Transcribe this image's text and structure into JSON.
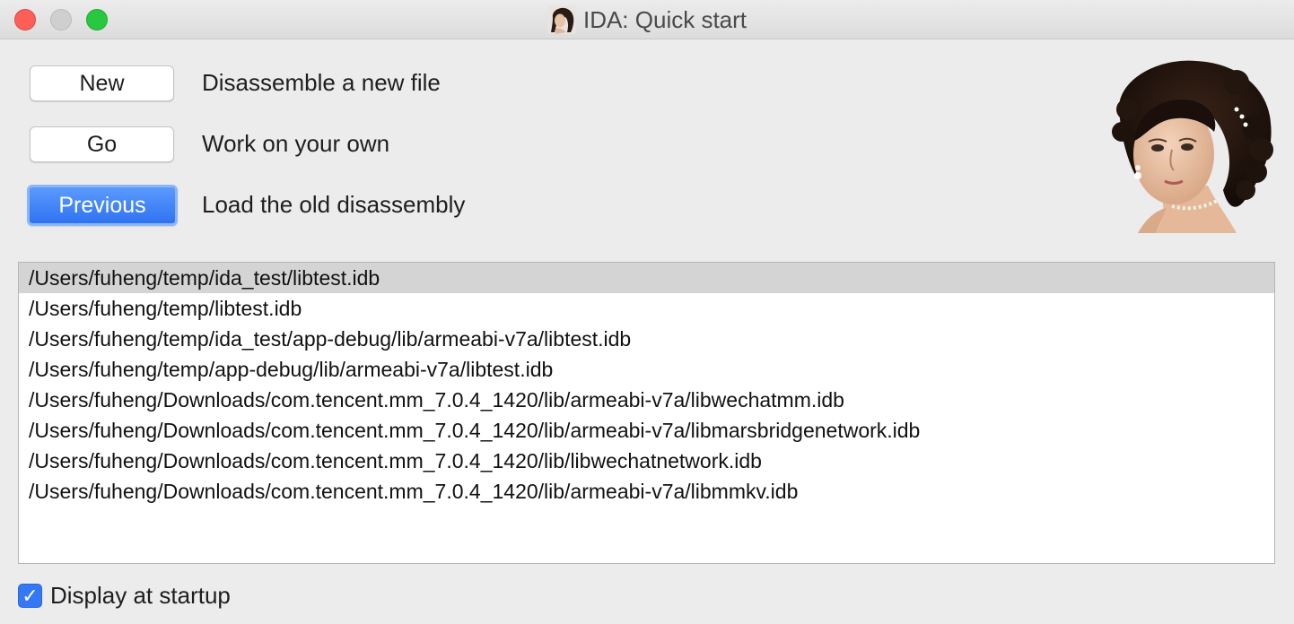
{
  "window": {
    "title": "IDA: Quick start",
    "app_icon": "portrait-icon"
  },
  "actions": [
    {
      "button_label": "New",
      "description": "Disassemble a new file"
    },
    {
      "button_label": "Go",
      "description": "Work on your own"
    },
    {
      "button_label": "Previous",
      "description": "Load the old disassembly",
      "default": true
    }
  ],
  "recent_files": {
    "selected_index": 0,
    "items": [
      "/Users/fuheng/temp/ida_test/libtest.idb",
      "/Users/fuheng/temp/libtest.idb",
      "/Users/fuheng/temp/ida_test/app-debug/lib/armeabi-v7a/libtest.idb",
      "/Users/fuheng/temp/app-debug/lib/armeabi-v7a/libtest.idb",
      "/Users/fuheng/Downloads/com.tencent.mm_7.0.4_1420/lib/armeabi-v7a/libwechatmm.idb",
      "/Users/fuheng/Downloads/com.tencent.mm_7.0.4_1420/lib/armeabi-v7a/libmarsbridgenetwork.idb",
      "/Users/fuheng/Downloads/com.tencent.mm_7.0.4_1420/lib/libwechatnetwork.idb",
      "/Users/fuheng/Downloads/com.tencent.mm_7.0.4_1420/lib/armeabi-v7a/libmmkv.idb"
    ]
  },
  "startup": {
    "label": "Display at startup",
    "checked": true
  },
  "colors": {
    "accent": "#3478f6",
    "selection": "#d4d4d4"
  }
}
